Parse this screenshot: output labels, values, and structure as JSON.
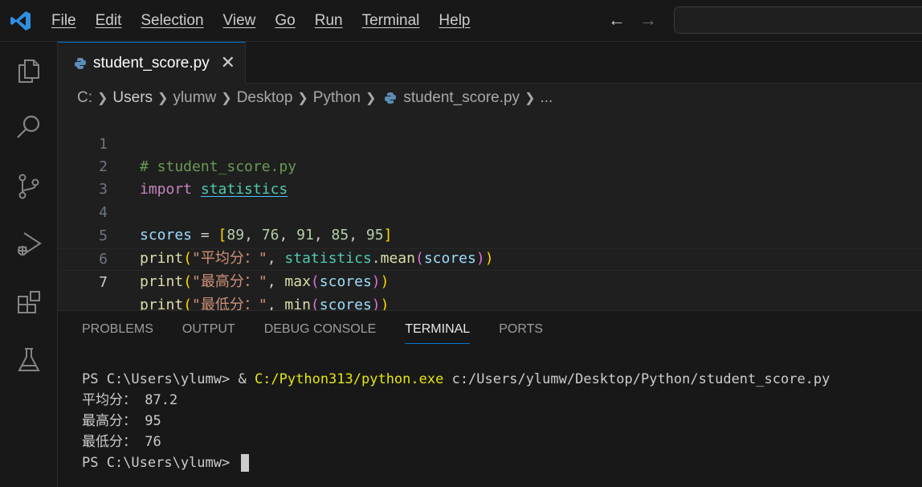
{
  "menu": [
    "File",
    "Edit",
    "Selection",
    "View",
    "Go",
    "Run",
    "Terminal",
    "Help"
  ],
  "nav": {
    "back": "←",
    "forward": "→"
  },
  "tab": {
    "label": "student_score.py",
    "close": "✕"
  },
  "breadcrumb": {
    "items": [
      "C:",
      "Users",
      "ylumw",
      "Desktop",
      "Python",
      "student_score.py",
      "..."
    ]
  },
  "editor": {
    "line_numbers": [
      "1",
      "2",
      "3",
      "4",
      "5",
      "6",
      "7"
    ],
    "line1": {
      "comment": "# student_score.py"
    },
    "line2": {
      "kw": "import",
      "mod": "statistics"
    },
    "line4": {
      "var": "scores",
      "eq": " = ",
      "open": "[",
      "n1": "89",
      "n2": "76",
      "n3": "91",
      "n4": "85",
      "n5": "95",
      "close": "]",
      "sep": ", "
    },
    "line5": {
      "fn": "print",
      "str": "\"平均分：\"",
      "mod": "statistics",
      "dot": ".",
      "fn2": "mean",
      "var": "scores"
    },
    "line6": {
      "fn": "print",
      "str": "\"最高分：\"",
      "fn2": "max",
      "var": "scores"
    },
    "line7": {
      "fn": "print",
      "str": "\"最低分：\"",
      "fn2": "min",
      "var": "scores"
    }
  },
  "panel": {
    "tabs": [
      "PROBLEMS",
      "OUTPUT",
      "DEBUG CONSOLE",
      "TERMINAL",
      "PORTS"
    ],
    "active_tab": "TERMINAL",
    "terminal": {
      "prompt1": "PS C:\\Users\\ylumw> & ",
      "exe": "C:/Python313/python.exe",
      "arg": " c:/Users/ylumw/Desktop/Python/student_score.py",
      "out1": "平均分： 87.2",
      "out2": "最高分： 95",
      "out3": "最低分： 76",
      "prompt2": "PS C:\\Users\\ylumw> "
    }
  },
  "colors": {
    "accent": "#0078d4",
    "bg": "#1f1f1f",
    "sidebar": "#181818"
  },
  "icons": [
    "vscode-logo-icon",
    "explorer-icon",
    "search-icon",
    "source-control-icon",
    "run-debug-icon",
    "extensions-icon",
    "testing-icon",
    "python-file-icon"
  ]
}
